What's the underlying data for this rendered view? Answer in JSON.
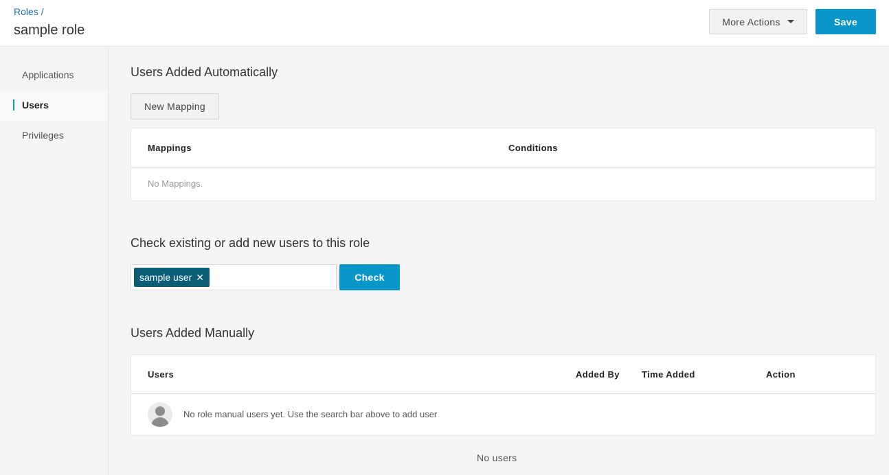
{
  "header": {
    "breadcrumb": "Roles",
    "breadcrumb_sep": "/",
    "title": "sample role",
    "more_actions_label": "More Actions",
    "save_label": "Save"
  },
  "sidebar": {
    "items": [
      {
        "label": "Applications",
        "active": false
      },
      {
        "label": "Users",
        "active": true
      },
      {
        "label": "Privileges",
        "active": false
      }
    ]
  },
  "auto_section": {
    "title": "Users Added Automatically",
    "new_mapping_label": "New Mapping",
    "columns": [
      "Mappings",
      "Conditions"
    ],
    "empty_text": "No Mappings."
  },
  "check_section": {
    "title": "Check existing or add new users to this role",
    "chip_label": "sample user",
    "chip_remove_glyph": "✕",
    "check_label": "Check"
  },
  "manual_section": {
    "title": "Users Added Manually",
    "columns": [
      "Users",
      "Added By",
      "Time Added",
      "Action"
    ],
    "empty_row_text": "No role manual users yet. Use the search bar above to add user",
    "footer_text": "No users"
  },
  "colors": {
    "accent": "#0a96c8",
    "chip": "#0b5d75",
    "link": "#1a73a8"
  },
  "icons": [
    "caret-down-icon",
    "close-icon",
    "user-avatar-icon"
  ]
}
